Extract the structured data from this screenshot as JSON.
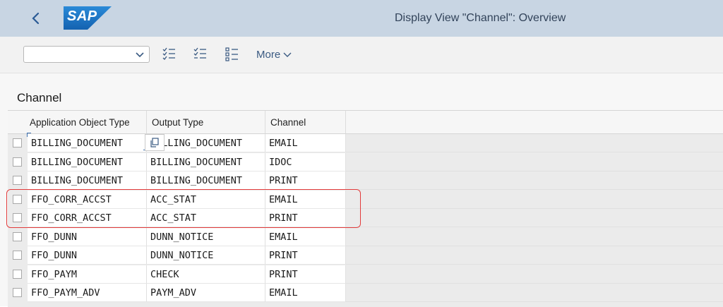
{
  "shellbar": {
    "logo_text": "SAP",
    "title": "Display View \"Channel\": Overview",
    "back_icon": "chevron-left-icon"
  },
  "toolbar": {
    "select_value": "",
    "buttons": [
      "select-all-icon",
      "deselect-all-icon",
      "select-block-icon"
    ],
    "more_label": "More"
  },
  "section": {
    "title": "Channel"
  },
  "table": {
    "columns": [
      "Application Object Type",
      "Output Type",
      "Channel"
    ],
    "rows": [
      [
        "BILLING_DOCUMENT",
        "BILLING_DOCUMENT",
        "EMAIL"
      ],
      [
        "BILLING_DOCUMENT",
        "BILLING_DOCUMENT",
        "IDOC"
      ],
      [
        "BILLING_DOCUMENT",
        "BILLING_DOCUMENT",
        "PRINT"
      ],
      [
        "FFO_CORR_ACCST",
        "ACC_STAT",
        "EMAIL"
      ],
      [
        "FFO_CORR_ACCST",
        "ACC_STAT",
        "PRINT"
      ],
      [
        "FFO_DUNN",
        "DUNN_NOTICE",
        "EMAIL"
      ],
      [
        "FFO_DUNN",
        "DUNN_NOTICE",
        "PRINT"
      ],
      [
        "FFO_PAYM",
        "CHECK",
        "PRINT"
      ],
      [
        "FFO_PAYM_ADV",
        "PAYM_ADV",
        "EMAIL"
      ]
    ]
  },
  "colors": {
    "shellbar": "#c8d5e3",
    "brand": "#1f79c8",
    "highlight": "#e23b3b"
  }
}
